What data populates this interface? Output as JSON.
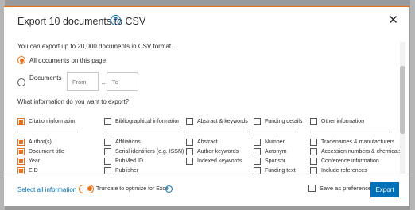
{
  "modal": {
    "title": "Export 10 documents to CSV",
    "help_icon": "?",
    "close_icon": "✕"
  },
  "intro": "You can export up to 20,000 documents in CSV format.",
  "scope": {
    "all_label": "All documents on this page",
    "all_selected": true,
    "documents_label": "Documents",
    "from_placeholder": "From",
    "to_placeholder": "To",
    "dash": "–"
  },
  "question": "What information do you want to export?",
  "groups": [
    {
      "label": "Citation information",
      "checked": true,
      "items": [
        {
          "label": "Author(s)",
          "checked": true
        },
        {
          "label": "Document title",
          "checked": true
        },
        {
          "label": "Year",
          "checked": true
        },
        {
          "label": "EID",
          "checked": true
        },
        {
          "label": "Source title",
          "checked": true
        }
      ]
    },
    {
      "label": "Bibliographical information",
      "checked": false,
      "items": [
        {
          "label": "Affiliations",
          "checked": false
        },
        {
          "label": "Serial identifiers (e.g. ISSN)",
          "checked": false
        },
        {
          "label": "PubMed ID",
          "checked": false
        },
        {
          "label": "Publisher",
          "checked": false
        },
        {
          "label": "Editor(s)",
          "checked": false
        }
      ]
    },
    {
      "label": "Abstract & keywords",
      "checked": false,
      "items": [
        {
          "label": "Abstract",
          "checked": false
        },
        {
          "label": "Author keywords",
          "checked": false
        },
        {
          "label": "Indexed keywords",
          "checked": false
        }
      ]
    },
    {
      "label": "Funding details",
      "checked": false,
      "items": [
        {
          "label": "Number",
          "checked": false
        },
        {
          "label": "Acronym",
          "checked": false
        },
        {
          "label": "Sponsor",
          "checked": false
        },
        {
          "label": "Funding text",
          "checked": false
        }
      ]
    },
    {
      "label": "Other information",
      "checked": false,
      "items": [
        {
          "label": "Tradenames & manufacturers",
          "checked": false
        },
        {
          "label": "Accession numbers & chemicals",
          "checked": false
        },
        {
          "label": "Conference information",
          "checked": false
        },
        {
          "label": "Include references",
          "checked": false
        }
      ]
    }
  ],
  "footer": {
    "select_all": "Select all information",
    "truncate_label": "Truncate to optimize for Excel",
    "truncate_on": true,
    "info_icon": "i",
    "save_pref_label": "Save as preference",
    "export_label": "Export"
  },
  "colors": {
    "accent": "#e9711c",
    "link": "#0070b8",
    "button": "#0070b8"
  }
}
